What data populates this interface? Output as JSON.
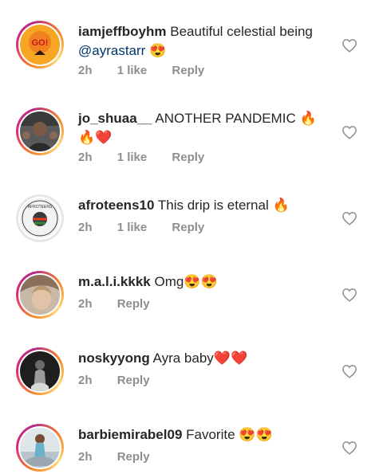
{
  "comments": [
    {
      "username": "iamjeffboyhm",
      "text": "Beautiful celestial being",
      "line2_mention": "@ayrastarr",
      "line2_emoji": "😍",
      "time": "2h",
      "likes": "1 like",
      "reply": "Reply",
      "avatar_label": "GO!"
    },
    {
      "username": "jo_shuaa__",
      "text": "ANOTHER PANDEMIC",
      "line1_emoji": "🔥",
      "line2_emoji": "🔥❤️",
      "time": "2h",
      "likes": "1 like",
      "reply": "Reply"
    },
    {
      "username": "afroteens10",
      "text": "This drip is eternal",
      "line1_emoji": "🔥",
      "time": "2h",
      "likes": "1 like",
      "reply": "Reply",
      "avatar_label": "AFROTEENS"
    },
    {
      "username": "m.a.l.i.kkkk",
      "text": "Omg😍😍",
      "time": "2h",
      "reply": "Reply"
    },
    {
      "username": "noskyyong",
      "text": "Ayra baby❤️❤️",
      "time": "2h",
      "reply": "Reply"
    },
    {
      "username": "barbiemirabel09",
      "text": "Favorite 😍😍",
      "time": "2h",
      "reply": "Reply"
    }
  ],
  "colors": {
    "heart_outline": "#8e8e8e",
    "meta": "#8e8e8e",
    "mention": "#00376b"
  }
}
